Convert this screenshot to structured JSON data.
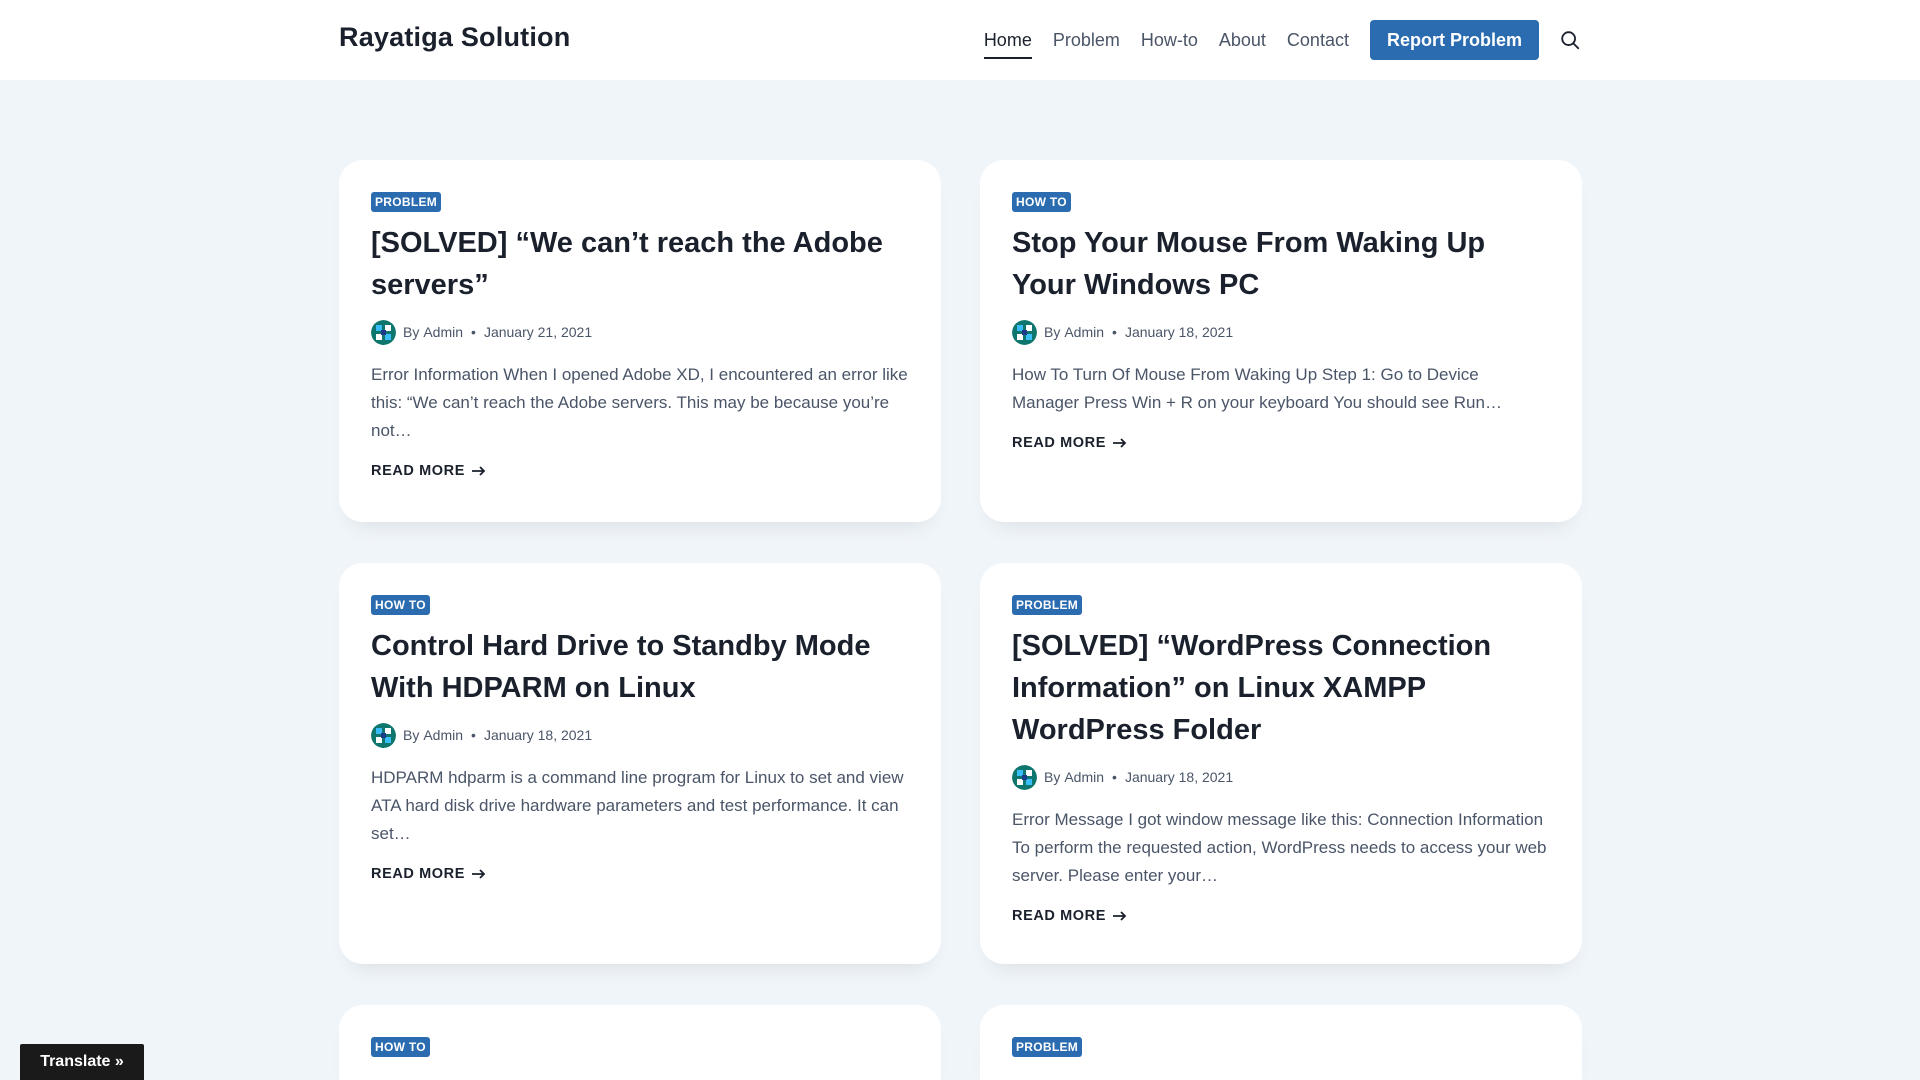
{
  "site": {
    "brand": "Rayatiga Solution"
  },
  "nav": {
    "items": [
      {
        "label": "Home",
        "active": true
      },
      {
        "label": "Problem",
        "active": false
      },
      {
        "label": "How-to",
        "active": false
      },
      {
        "label": "About",
        "active": false
      },
      {
        "label": "Contact",
        "active": false
      }
    ],
    "cta_label": "Report Problem",
    "search_icon": "search-icon"
  },
  "colors": {
    "accent": "#2b6cb0",
    "page_background": "#f0f5fa",
    "heading": "#1a202c",
    "body_text": "#4a5568"
  },
  "posts": [
    {
      "category": "PROBLEM",
      "title": "[SOLVED] “We can’t reach the Adobe servers”",
      "by": "By",
      "author": "Admin",
      "date": "January 21, 2021",
      "excerpt": "Error Information When I opened Adobe XD, I encountered an error like this: “We can’t reach the Adobe servers. This may be because you’re not…",
      "read_more": "READ MORE"
    },
    {
      "category": "HOW TO",
      "title": "Stop Your Mouse From Waking Up Your Windows PC",
      "by": "By",
      "author": "Admin",
      "date": "January 18, 2021",
      "excerpt": "How To Turn Of Mouse From Waking Up Step 1: Go to Device Manager Press Win + R on your keyboard You should see Run…",
      "read_more": "READ MORE"
    },
    {
      "category": "HOW TO",
      "title": "Control Hard Drive to Standby Mode With HDPARM on Linux",
      "by": "By",
      "author": "Admin",
      "date": "January 18, 2021",
      "excerpt": "HDPARM hdparm is a command line program for Linux to set and view ATA hard disk drive hardware parameters and test performance. It can set…",
      "read_more": "READ MORE"
    },
    {
      "category": "PROBLEM",
      "title": "[SOLVED] “WordPress Connection Information” on Linux XAMPP WordPress Folder",
      "by": "By",
      "author": "Admin",
      "date": "January 18, 2021",
      "excerpt": "Error Message I got window message like this: Connection Information To perform the requested action, WordPress needs to access your web server. Please enter your…",
      "read_more": "READ MORE"
    },
    {
      "category": "HOW TO"
    },
    {
      "category": "PROBLEM"
    }
  ],
  "translate": {
    "label": "Translate »"
  }
}
